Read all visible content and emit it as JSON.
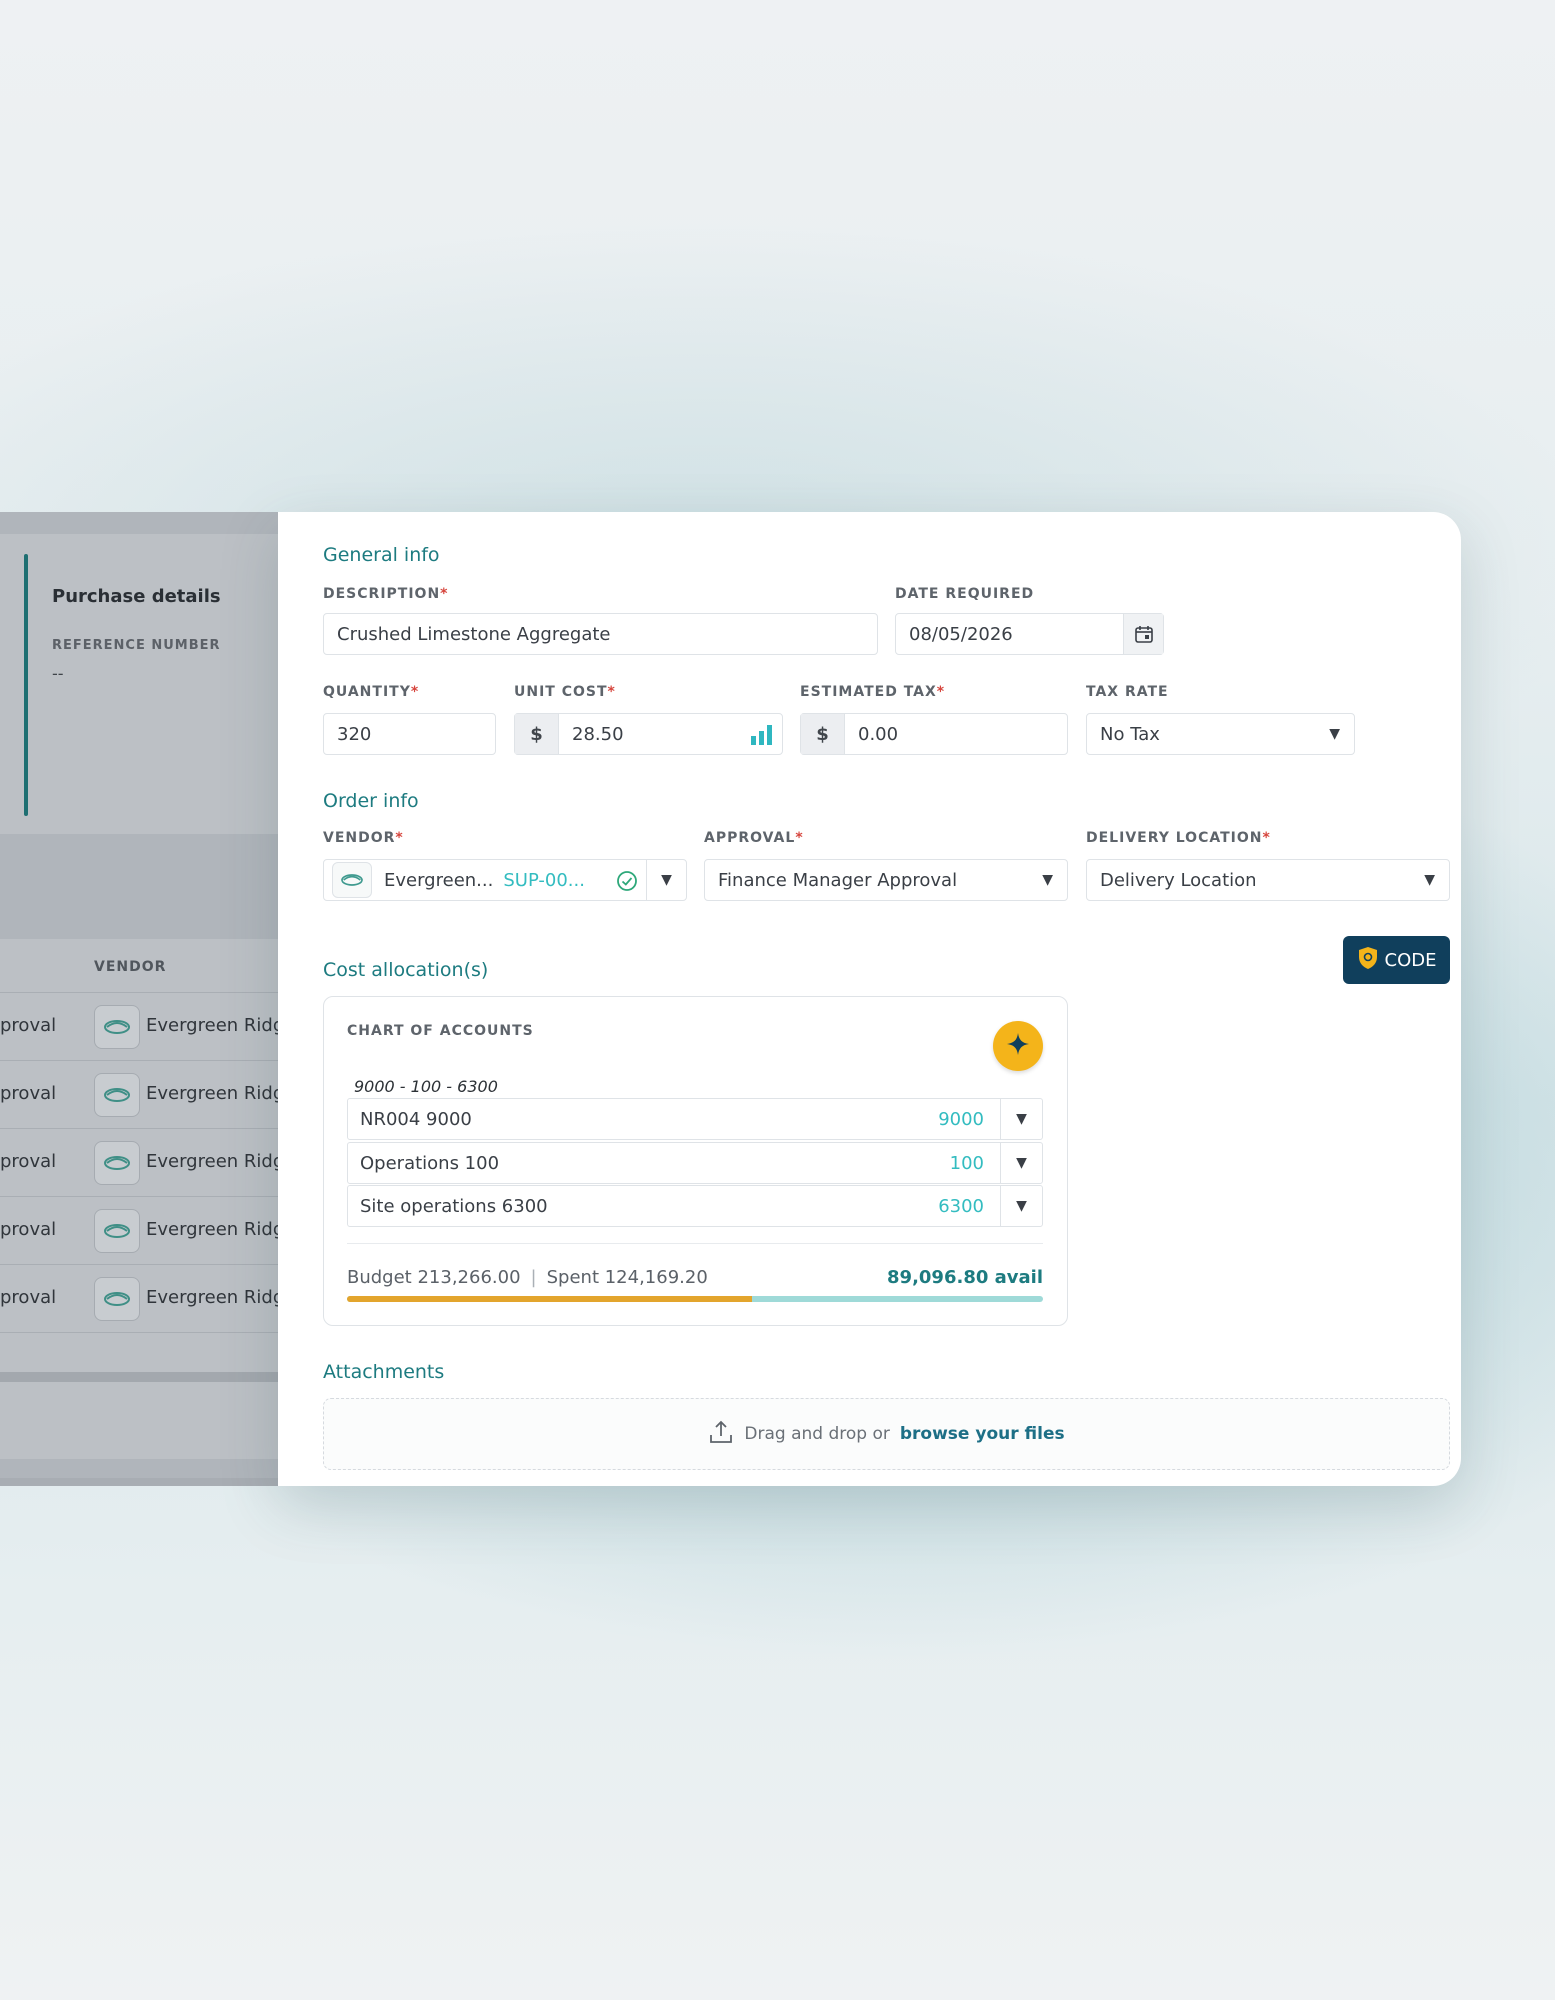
{
  "background": {
    "purchase_details_title": "Purchase details",
    "reference_number_label": "REFERENCE NUMBER",
    "reference_number_value": "--",
    "vendor_column_header": "VENDOR",
    "rows": [
      {
        "status": "proval",
        "vendor": "Evergreen Ridge"
      },
      {
        "status": "proval",
        "vendor": "Evergreen Ridge"
      },
      {
        "status": "proval",
        "vendor": "Evergreen Ridge"
      },
      {
        "status": "proval",
        "vendor": "Evergreen Ridge"
      },
      {
        "status": "proval",
        "vendor": "Evergreen Ridge"
      }
    ]
  },
  "general_info": {
    "title": "General info",
    "description_label": "DESCRIPTION",
    "description_value": "Crushed Limestone Aggregate",
    "date_required_label": "DATE REQUIRED",
    "date_required_value": "08/05/2026",
    "quantity_label": "QUANTITY",
    "quantity_value": "320",
    "unit_cost_label": "UNIT COST",
    "unit_cost_prefix": "$",
    "unit_cost_value": "28.50",
    "estimated_tax_label": "ESTIMATED TAX",
    "estimated_tax_prefix": "$",
    "estimated_tax_value": "0.00",
    "tax_rate_label": "TAX RATE",
    "tax_rate_value": "No Tax",
    "required_marker": "*"
  },
  "order_info": {
    "title": "Order info",
    "vendor_label": "VENDOR",
    "vendor_name": "Evergreen...",
    "vendor_code": "SUP-00...",
    "approval_label": "APPROVAL",
    "approval_value": "Finance Manager Approval",
    "delivery_location_label": "DELIVERY LOCATION",
    "delivery_location_value": "Delivery Location"
  },
  "cost_allocation": {
    "title": "Cost allocation(s)",
    "code_button_label": "CODE",
    "chart_of_accounts_label": "CHART OF ACCOUNTS",
    "code_path": "9000 - 100 - 6300",
    "segments": [
      {
        "name": "NR004 9000",
        "code": "9000"
      },
      {
        "name": "Operations 100",
        "code": "100"
      },
      {
        "name": "Site operations 6300",
        "code": "6300"
      }
    ],
    "budget_text": "Budget 213,266.00",
    "spent_text": "Spent 124,169.20",
    "separator": "|",
    "available_text": "89,096.80 avail",
    "spent_fraction": 0.582
  },
  "attachments": {
    "title": "Attachments",
    "drop_text": "Drag and drop or",
    "browse_link": "browse your files"
  },
  "colors": {
    "accent_teal": "#1d7b80",
    "code_button_bg": "#103f5c",
    "spark_yellow": "#f4b41a",
    "budget_spent": "#e3a52d",
    "budget_remaining": "#9fdad8"
  }
}
